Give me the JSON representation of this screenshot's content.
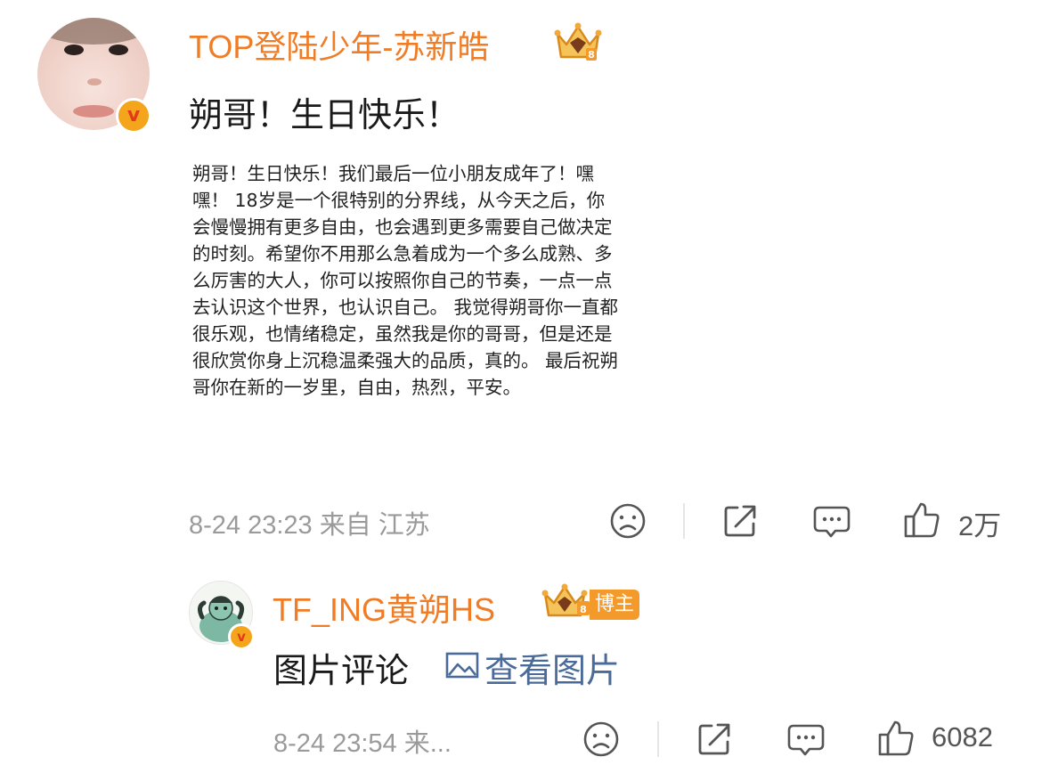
{
  "post": {
    "author": "TOP登陆少年-苏新皓",
    "headline": "朔哥！生日快乐！",
    "letter": "朔哥！生日快乐！我们最后一位小朋友成年了！嘿嘿！ 18岁是一个很特别的分界线，从今天之后，你会慢慢拥有更多自由，也会遇到更多需要自己做决定的时刻。希望你不用那么急着成为一个多么成熟、多么厉害的大人，你可以按照你自己的节奏，一点一点去认识这个世界，也认识自己。 我觉得朔哥你一直都很乐观，也情绪稳定，虽然我是你的哥哥，但是还是很欣赏你身上沉稳温柔强大的品质，真的。 最后祝朔哥你在新的一岁里，自由，热烈，平安。",
    "meta": "8-24 23:23 来自 江苏",
    "likes": "2万",
    "verified_badge": "v"
  },
  "reply": {
    "author": "TF_ING黄朔HS",
    "author_tag": "博主",
    "text": "图片评论",
    "view_picture": "查看图片",
    "meta": "8-24 23:54 来...",
    "likes": "6082",
    "verified_badge": "v"
  },
  "icons": {
    "crown": "crown-badge-icon",
    "dislike": "sad-face-icon",
    "share": "share-icon",
    "comment": "comment-icon",
    "like": "thumbs-up-icon",
    "picture": "image-icon"
  },
  "colors": {
    "name": "#f07c26",
    "link": "#4a6a9a",
    "meta": "#9a9a9a",
    "tag": "#f39a2a"
  }
}
